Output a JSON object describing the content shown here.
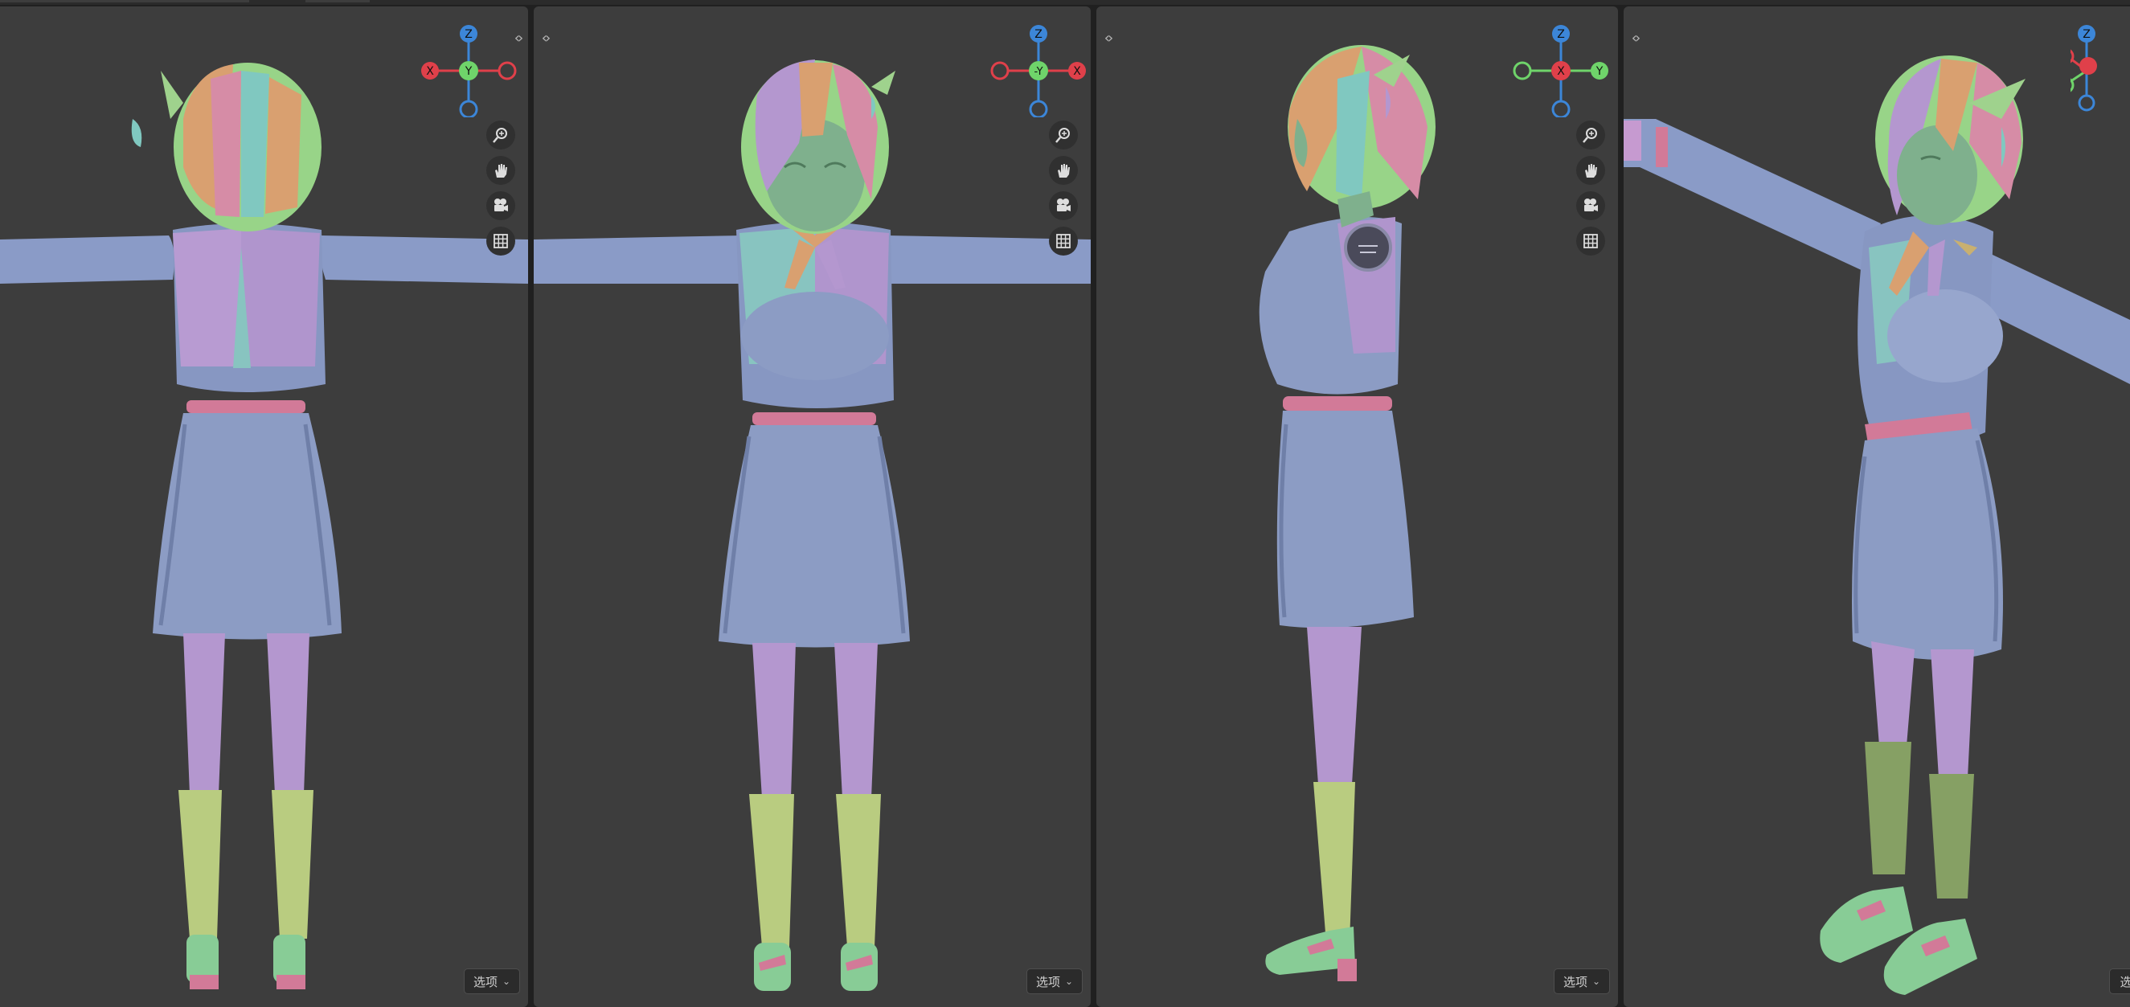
{
  "viewports": [
    {
      "name": "back-view",
      "gizmo": {
        "up": "Z",
        "center": "Y",
        "left": "X",
        "right": "",
        "bottom": ""
      },
      "options_label": "选项"
    },
    {
      "name": "front-view",
      "gizmo": {
        "up": "Z",
        "center": "-Y",
        "left": "",
        "right": "X",
        "bottom": ""
      },
      "options_label": "选项"
    },
    {
      "name": "side-view",
      "gizmo": {
        "up": "Z",
        "center": "X",
        "left": "",
        "right": "Y",
        "bottom": ""
      },
      "options_label": "选项"
    },
    {
      "name": "perspective-view",
      "gizmo": {
        "up": "Z",
        "center": "",
        "left": "",
        "right": "",
        "bottom": ""
      },
      "options_label": "选"
    }
  ],
  "nav_tools": [
    "zoom-icon",
    "hand-pan-icon",
    "camera-icon",
    "grid-icon"
  ],
  "colors": {
    "viewport_bg": "#3d3d3d",
    "axis_x": "#e0404a",
    "axis_y": "#6fd46a",
    "axis_z": "#3c86d8",
    "uniform": "#8c9cc4",
    "skin": "#7fb08d",
    "stockings": "#b497cf",
    "socks": "#b9cc80",
    "belt": "#d27a98",
    "hair_orange": "#d9a070",
    "hair_pink": "#d68ca6",
    "hair_teal": "#80c8c0",
    "hair_green": "#98d488"
  }
}
